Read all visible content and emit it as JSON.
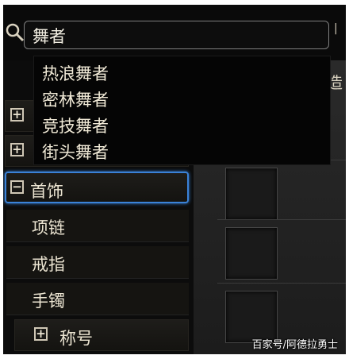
{
  "search": {
    "value": "舞者"
  },
  "suggestions": [
    "热浪舞者",
    "密林舞者",
    "竞技舞者",
    "街头舞者"
  ],
  "right_panel": {
    "header_fragment": "造"
  },
  "categories": [
    {
      "label": "首饰",
      "toggle": "−",
      "expanded": true,
      "selected": true
    },
    {
      "label": "称号",
      "toggle": "+",
      "expanded": false
    }
  ],
  "subitems": [
    "项链",
    "戒指",
    "手镯"
  ],
  "watermark": "百家号/阿德拉勇士",
  "icons": {
    "search": "search-icon",
    "expand": "plus-box-icon",
    "collapse": "minus-box-icon"
  },
  "colors": {
    "selection_border": "#3a82d8",
    "text": "#ece5d2"
  }
}
